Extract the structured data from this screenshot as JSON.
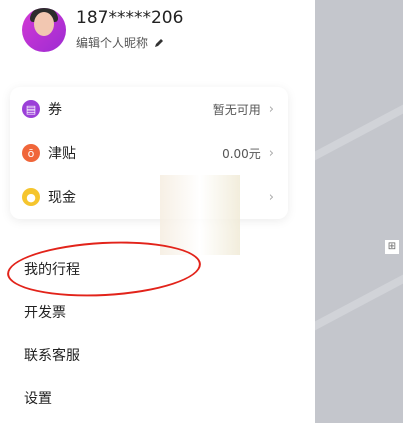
{
  "profile": {
    "phone": "187*****206",
    "nickname_edit": "编辑个人昵称"
  },
  "wallet": {
    "items": [
      {
        "label": "券",
        "value": "暂无可用",
        "icon": "coupon-icon",
        "color": "#9b3fd8"
      },
      {
        "label": "津贴",
        "value": "0.00元",
        "icon": "allowance-icon",
        "color": "#f0663a"
      },
      {
        "label": "现金",
        "value": "",
        "icon": "cash-icon",
        "color": "#f5c52e"
      }
    ]
  },
  "menu": [
    {
      "label": "我的行程"
    },
    {
      "label": "开发票"
    },
    {
      "label": "联系客服"
    },
    {
      "label": "设置"
    }
  ],
  "colors": {
    "annotation": "#e2231a"
  }
}
